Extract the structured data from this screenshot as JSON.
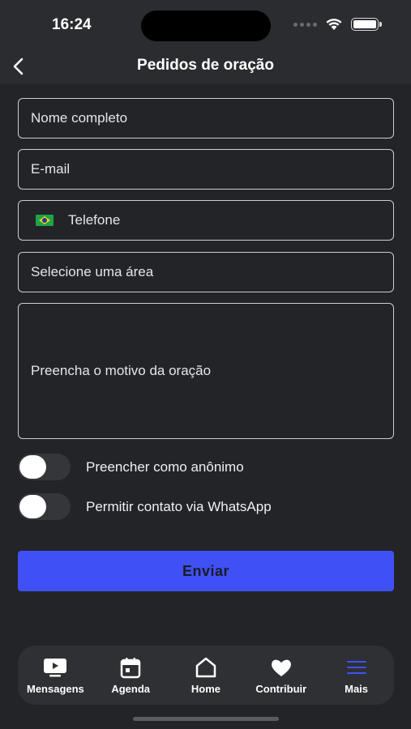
{
  "status": {
    "time": "16:24"
  },
  "header": {
    "title": "Pedidos de oração"
  },
  "form": {
    "name_placeholder": "Nome completo",
    "email_placeholder": "E-mail",
    "phone_placeholder": "Telefone",
    "area_placeholder": "Selecione uma área",
    "reason_placeholder": "Preencha o motivo da oração"
  },
  "toggles": {
    "anonymous_label": "Preencher como anônimo",
    "anonymous_on": false,
    "whatsapp_label": "Permitir contato via WhatsApp",
    "whatsapp_on": false
  },
  "submit_label": "Enviar",
  "tabbar": {
    "items": [
      {
        "label": "Mensagens",
        "icon": "video-play-icon"
      },
      {
        "label": "Agenda",
        "icon": "calendar-icon"
      },
      {
        "label": "Home",
        "icon": "home-icon"
      },
      {
        "label": "Contribuir",
        "icon": "heart-icon"
      },
      {
        "label": "Mais",
        "icon": "menu-icon",
        "active": true
      }
    ]
  },
  "colors": {
    "accent": "#3f51f5",
    "background": "#232427",
    "tab_active": "#3f51f5"
  }
}
